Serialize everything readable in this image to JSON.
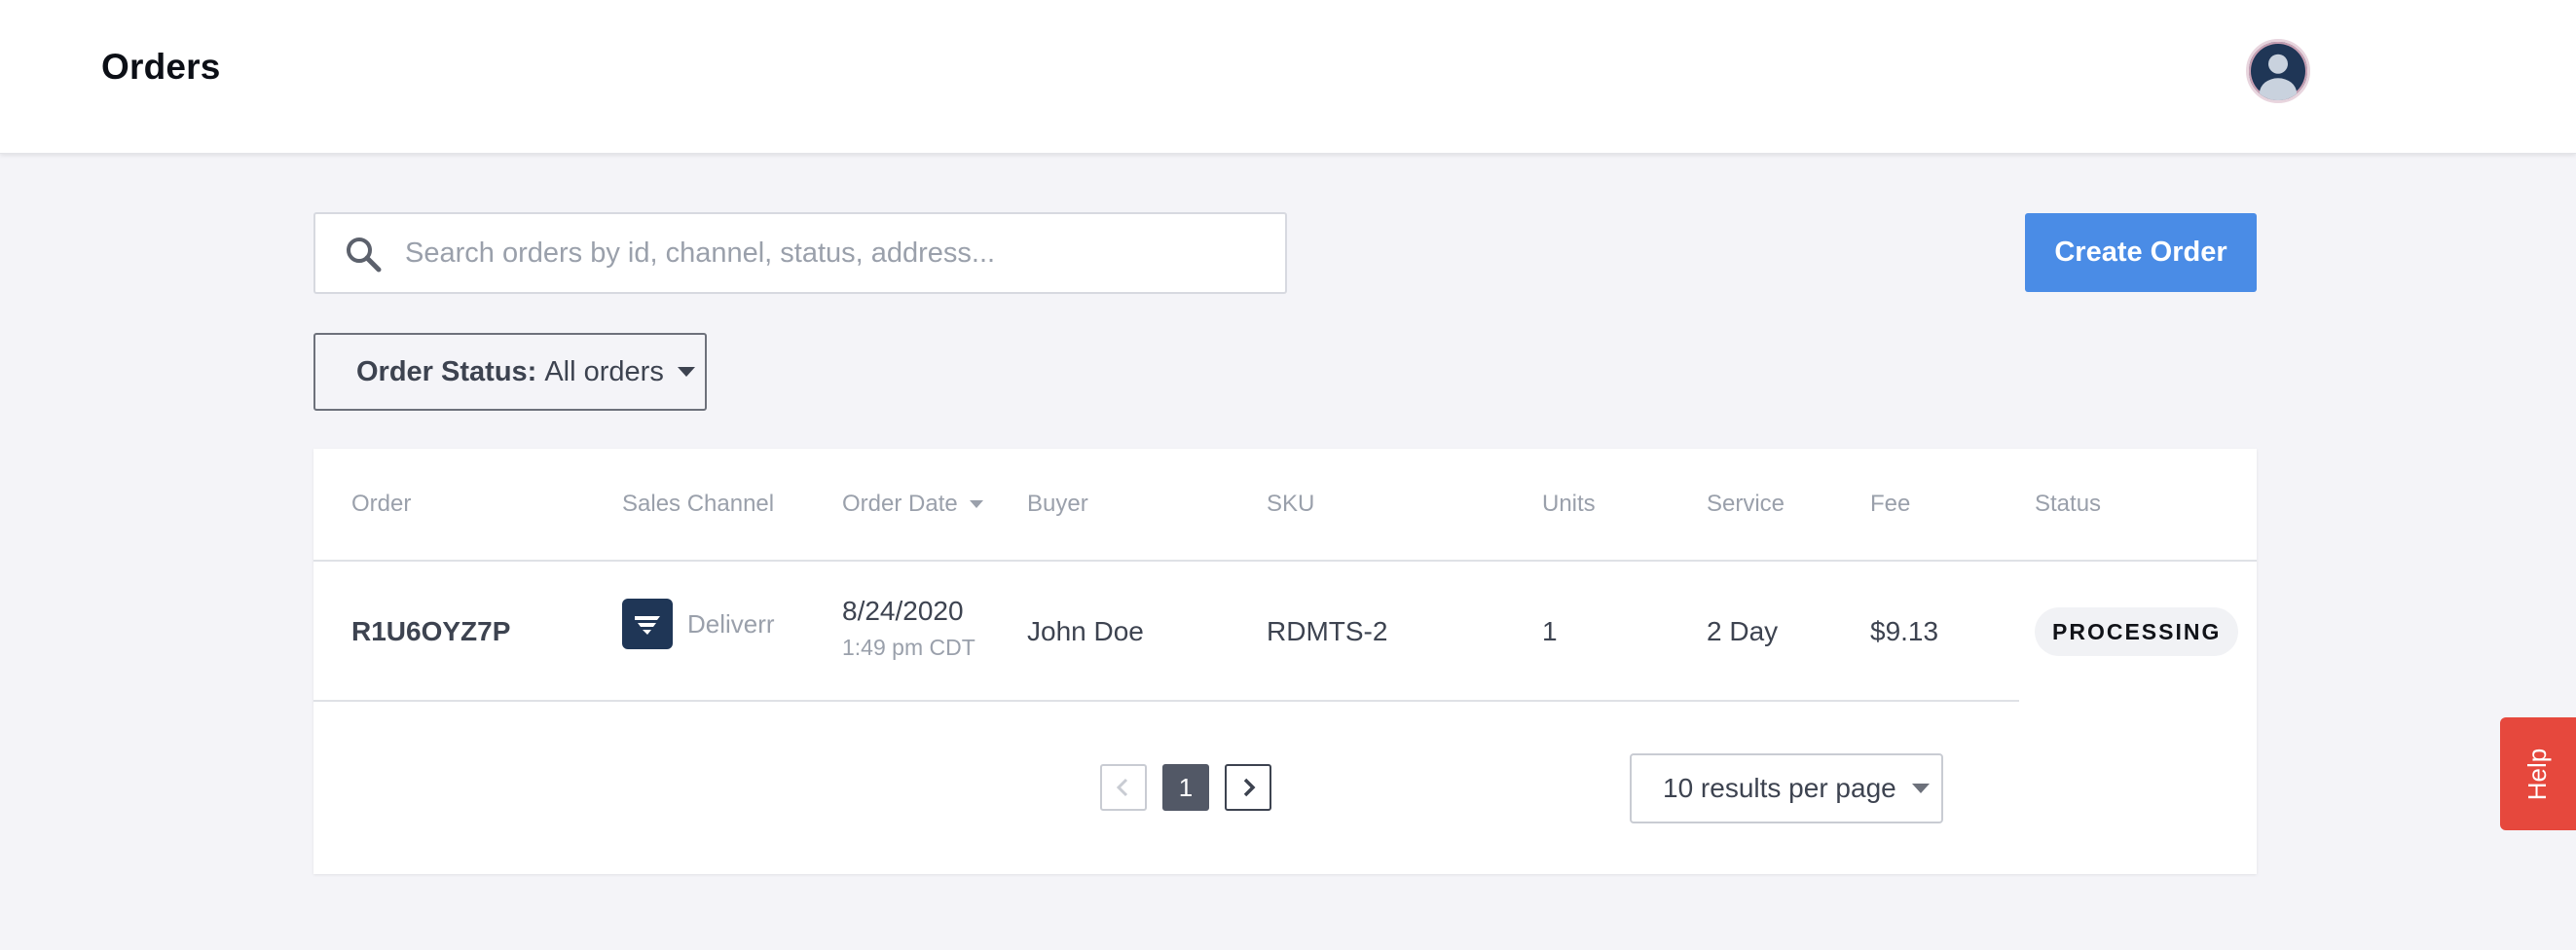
{
  "header": {
    "title": "Orders"
  },
  "search": {
    "placeholder": "Search orders by id, channel, status, address..."
  },
  "actions": {
    "create_order_label": "Create Order"
  },
  "filter": {
    "label": "Order Status:",
    "value": "All orders"
  },
  "table": {
    "columns": [
      "Order",
      "Sales Channel",
      "Order Date",
      "Buyer",
      "SKU",
      "Units",
      "Service",
      "Fee",
      "Status"
    ],
    "rows": [
      {
        "order": "R1U6OYZ7P",
        "sales_channel": "Deliverr",
        "order_date": "8/24/2020",
        "order_time": "1:49 pm CDT",
        "buyer": "John Doe",
        "sku": "RDMTS-2",
        "units": "1",
        "service": "2 Day",
        "fee": "$9.13",
        "status": "PROCESSING"
      }
    ]
  },
  "pagination": {
    "current_page": "1",
    "per_page_label": "10 results per page"
  },
  "help": {
    "label": "Help"
  },
  "colors": {
    "accent": "#4a8ce6",
    "help": "#e6483d",
    "channel_logo": "#1f3656"
  }
}
